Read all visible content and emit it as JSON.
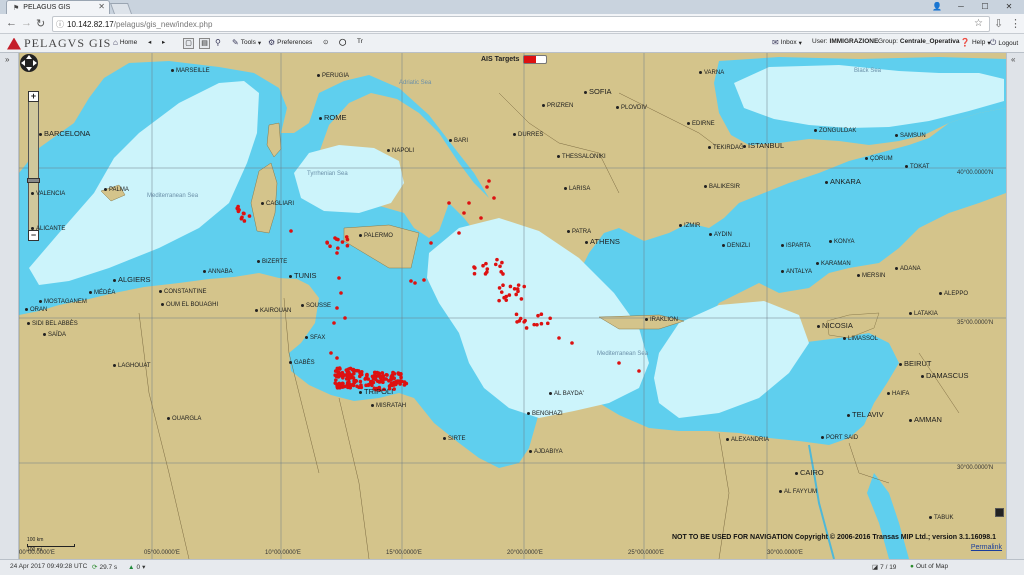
{
  "browser": {
    "tab_title": "PELAGUS GIS",
    "url_host": "10.142.82.17",
    "url_path": "/pelagus/gis_new/index.php"
  },
  "toolbar": {
    "logo_text": "PELAGVS GIS",
    "home": "Home",
    "tools": "Tools",
    "preferences": "Preferences",
    "tr": "Tr",
    "inbox": "Inbox",
    "user_label": "User:",
    "user_value": "IMMIGRAZIONE",
    "group_label": "Group:",
    "group_value": "Centrale_Operativa",
    "help": "Help",
    "logout": "Logout"
  },
  "map": {
    "ais_label": "AIS Targets",
    "copyright": "NOT TO BE USED FOR NAVIGATION Copyright © 2006-2016 Transas MIP Ltd.; version 3.1.16098.1",
    "permalink": "Permalink",
    "scale_top": "100 km",
    "scale_bottom": "100 mi",
    "land_color": "#d4c48b",
    "sea_color": "#5fcfee",
    "deep_color": "#ccf4fb",
    "target_color": "#dd1111"
  },
  "labels": {
    "marseille": "MARSEILLE",
    "barcelona": "BARCELONA",
    "palma": "PALMA",
    "valencia": "VALENCIA",
    "alicante": "ALICANTE",
    "cagliari": "CAGLIARI",
    "rome": "ROME",
    "napoli": "NAPOLI",
    "palermo": "PALERMO",
    "bari": "BARI",
    "perugia": "PERUGIA",
    "tunis": "TUNIS",
    "bizerte": "BIZERTE",
    "sousse": "SOUSSE",
    "sfax": "SFAX",
    "kairouan": "KAIROUAN",
    "gabes": "GABÈS",
    "tripoli": "TRIPOLI",
    "misratah": "MISRATAH",
    "sirte": "SIRTE",
    "benghazi": "BENGHAZI",
    "al_bayda": "AL BAYDA'",
    "ajdabiya": "AJDABIYA",
    "algiers": "ALGIERS",
    "oran": "ORAN",
    "medea": "MÉDÉA",
    "mostaganem": "MOSTAGANEM",
    "sidi_bel_abbes": "SIDI BEL ABBÈS",
    "saida": "SAÏDA",
    "laghouat": "LAGHOUAT",
    "ouargla": "OUARGLA",
    "annaba": "ANNABA",
    "constantine": "CONSTANTINE",
    "oum_el_bouaghi": "OUM EL BOUAGHI",
    "athens": "ATHENS",
    "patra": "PATRA",
    "larisa": "LARISA",
    "thessaloniki": "THESSALONIKI",
    "durres": "DURRES",
    "sofia": "SOFIA",
    "plovdiv": "PLOVDIV",
    "prizren": "PRIZREN",
    "varna": "VARNA",
    "edirne": "EDIRNE",
    "istanbul": "ISTANBUL",
    "tekirdag": "TEKIRDAĞ",
    "ankara": "ANKARA",
    "balikesir": "BALIKESIR",
    "izmir": "IZMIR",
    "aydin": "AYDIN",
    "denizli": "DENIZLI",
    "isparta": "ISPARTA",
    "antalya": "ANTALYA",
    "konya": "KONYA",
    "karaman": "KARAMAN",
    "mersin": "MERSIN",
    "adana": "ADANA",
    "iraklion": "IRAKLION",
    "nicosia": "NICOSIA",
    "limassol": "LIMASSOL",
    "beirut": "BEIRUT",
    "damascus": "DAMASCUS",
    "tel_aviv": "TEL AVIV",
    "amman": "AMMAN",
    "alexandria": "ALEXANDRIA",
    "cairo": "CAIRO",
    "port_said": "PORT SAID",
    "al_fayyum": "AL FAYYUM",
    "zonguldak": "ZONGULDAK",
    "samsun": "SAMSUN",
    "corum": "ÇORUM",
    "tokat": "TOKAT",
    "latakia": "LATAKIA",
    "aleppo": "ALEPPO",
    "haifa": "HAIFA",
    "tabuk": "TABUK",
    "black_sea": "Black Sea",
    "adriatic_sea": "Adriatic Sea",
    "tyrrhenian_sea": "Tyrrhenian Sea",
    "mediterranean_sea_w": "Mediterranean Sea",
    "mediterranean_sea_e": "Mediterranean Sea",
    "lat_40": "40°00.0000'N",
    "lat_35": "35°00.0000'N",
    "lat_30": "30°00.0000'N",
    "lon_0": "00°00.0000'E",
    "lon_5": "05°00.0000'E",
    "lon_10": "10°00.0000'E",
    "lon_15": "15°00.0000'E",
    "lon_20": "20°00.0000'E",
    "lon_25": "25°00.0000'E",
    "lon_30": "30°00.0000'E"
  },
  "status": {
    "datetime": "24 Apr 2017 09:49:28 UTC",
    "refresh": "29.7 s",
    "alerts": "0",
    "pages": "7 / 19",
    "out_of_map": "Out of Map"
  }
}
